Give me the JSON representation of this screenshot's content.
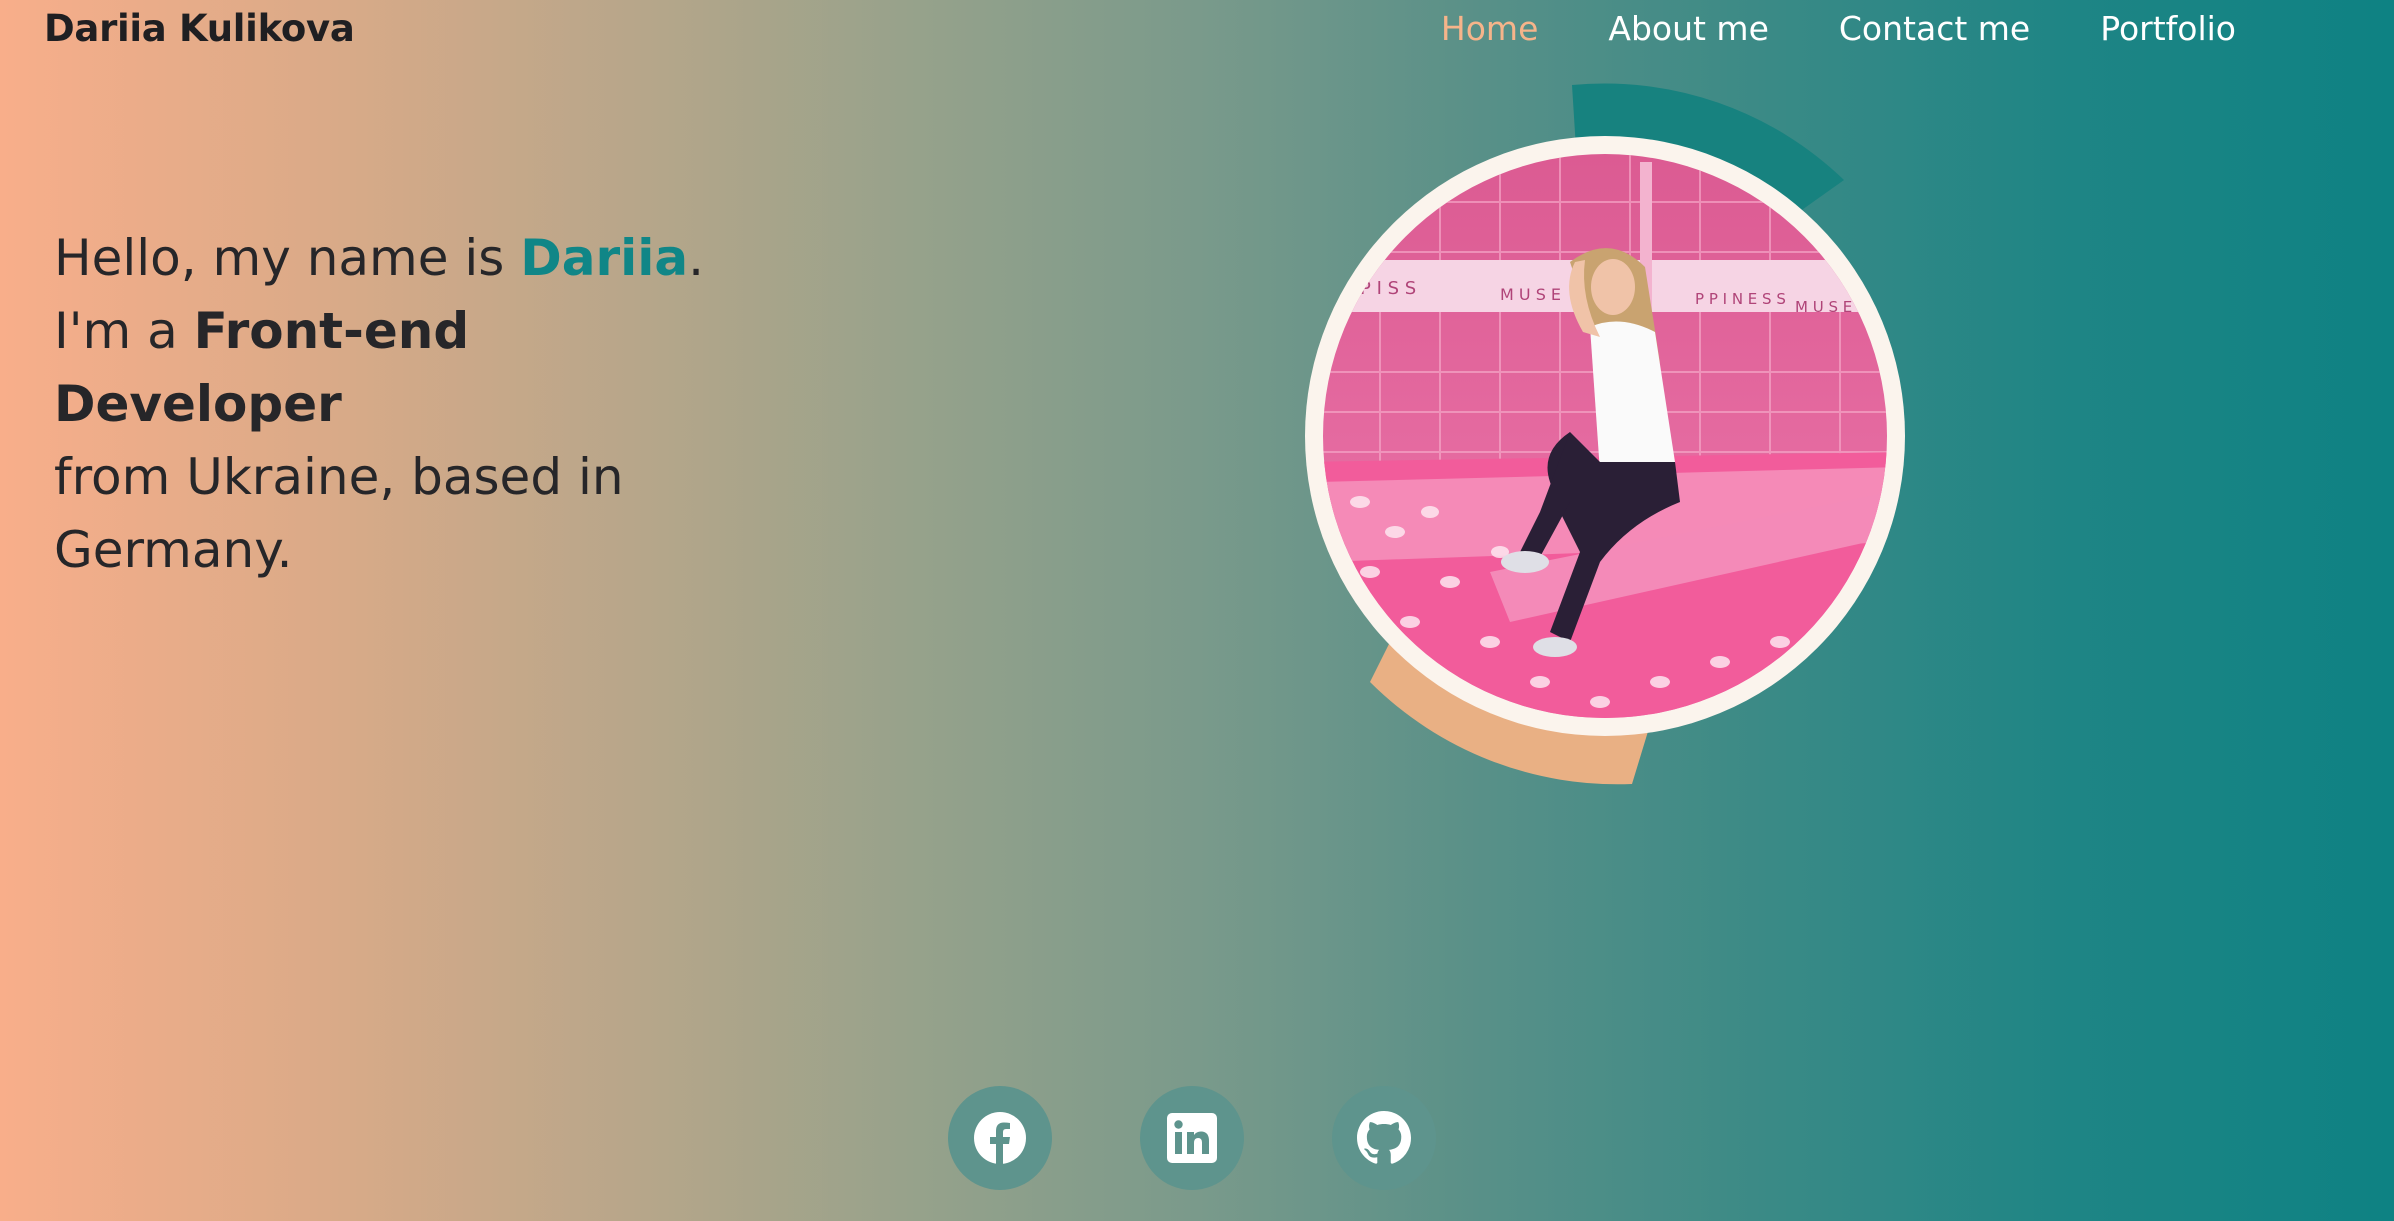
{
  "header": {
    "logo": "Dariia Kulikova"
  },
  "nav": {
    "items": [
      {
        "label": "Home",
        "active": true
      },
      {
        "label": "About me",
        "active": false
      },
      {
        "label": "Contact me",
        "active": false
      },
      {
        "label": "Portfolio",
        "active": false
      }
    ]
  },
  "intro": {
    "line1_prefix": "Hello, my name is ",
    "name": "Dariia",
    "line1_suffix": ".",
    "line2_prefix": "I'm a ",
    "role": "Front-end Developer",
    "line3": "from Ukraine, based in Germany."
  },
  "photo": {
    "background_lettering": [
      "P I S S",
      "M U S E",
      "P P I N E S S",
      "M U S E"
    ]
  },
  "socials": [
    {
      "icon": "facebook-icon"
    },
    {
      "icon": "linkedin-icon"
    },
    {
      "icon": "github-icon"
    }
  ],
  "colors": {
    "accent": "#108687",
    "active_nav": "#f6b48a",
    "gradient_start": "#f8ae8a",
    "gradient_end": "#0e8283",
    "social_bg": "#5e948d"
  }
}
